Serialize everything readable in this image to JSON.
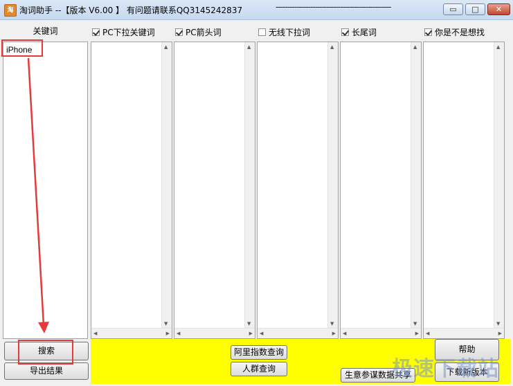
{
  "titlebar": {
    "title": "淘词助手 --【版本 V6.00 】 有问题请联系QQ3145242837",
    "dashes": "--------------------------------------------------",
    "minimize": "▭",
    "maximize": "□",
    "close": "✕"
  },
  "keyword_panel": {
    "header": "关键词",
    "items": [
      "iPhone"
    ]
  },
  "columns": [
    {
      "label": "PC下拉关键词",
      "checked": true
    },
    {
      "label": "PC箭头词",
      "checked": true
    },
    {
      "label": "无线下拉词",
      "checked": false
    },
    {
      "label": "长尾词",
      "checked": true
    },
    {
      "label": "你是不是想找",
      "checked": true
    }
  ],
  "buttons": {
    "search": "搜索",
    "export": "导出结果",
    "ali_index": "阿里指数查询",
    "crowd": "人群查询",
    "business_advisor": "生意参谋数据共享",
    "help": "帮助",
    "download": "下载新版本"
  },
  "scroll_arrows": {
    "up": "▲",
    "down": "▼",
    "left": "◀",
    "right": "▶"
  },
  "watermark": "极速下载站",
  "colors": {
    "bottom_bar": "#ffff00",
    "highlight": "#e53a3a"
  }
}
